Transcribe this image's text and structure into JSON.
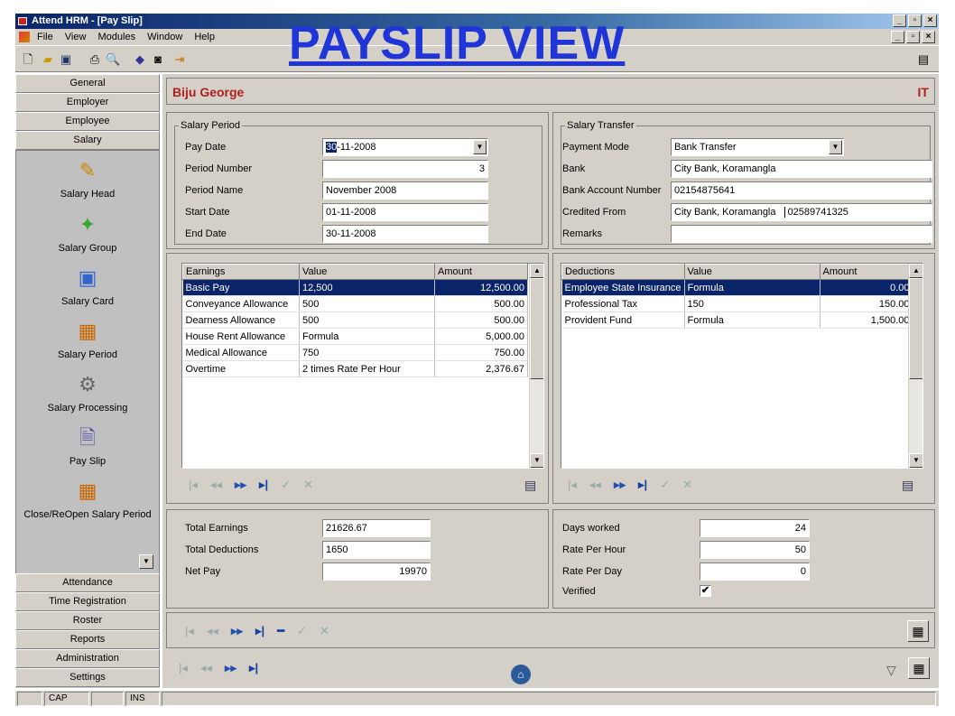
{
  "window": {
    "title": "Attend HRM - [Pay Slip]"
  },
  "menu": [
    "File",
    "View",
    "Modules",
    "Window",
    "Help"
  ],
  "overlay_title": "PAYSLIP VIEW",
  "sidebar": {
    "top_buttons": [
      "General",
      "Employer",
      "Employee",
      "Salary"
    ],
    "items": [
      {
        "label": "Salary Head",
        "icon": "salary-head-icon"
      },
      {
        "label": "Salary Group",
        "icon": "salary-group-icon"
      },
      {
        "label": "Salary Card",
        "icon": "salary-card-icon"
      },
      {
        "label": "Salary Period",
        "icon": "calendar-icon"
      },
      {
        "label": "Salary Processing",
        "icon": "gear-icon"
      },
      {
        "label": "Pay Slip",
        "icon": "document-icon"
      },
      {
        "label": "Close/ReOpen Salary Period",
        "icon": "calendar-icon"
      }
    ],
    "bottom_buttons": [
      "Attendance",
      "Time Registration",
      "Roster",
      "Reports",
      "Administration",
      "Settings"
    ]
  },
  "employee": {
    "name": "Biju George",
    "department": "IT"
  },
  "salary_period": {
    "legend": "Salary Period",
    "pay_date_label": "Pay Date",
    "pay_date_day": "30",
    "pay_date_rest": "-11-2008",
    "period_number_label": "Period Number",
    "period_number": "3",
    "period_name_label": "Period Name",
    "period_name": "November 2008",
    "start_date_label": "Start Date",
    "start_date": "01-11-2008",
    "end_date_label": "End Date",
    "end_date": "30-11-2008"
  },
  "salary_transfer": {
    "legend": "Salary Transfer",
    "payment_mode_label": "Payment Mode",
    "payment_mode": "Bank Transfer",
    "bank_label": "Bank",
    "bank": "City Bank, Koramangla",
    "account_label": "Bank Account Number",
    "account": "02154875641",
    "credited_from_label": "Credited From",
    "credited_from": "City Bank, Koramangla",
    "credited_from_account": "02589741325",
    "remarks_label": "Remarks",
    "remarks": ""
  },
  "earnings": {
    "headers": [
      "Earnings",
      "Value",
      "Amount"
    ],
    "rows": [
      [
        "Basic Pay",
        "12,500",
        "12,500.00"
      ],
      [
        "Conveyance Allowance",
        "500",
        "500.00"
      ],
      [
        "Dearness Allowance",
        "500",
        "500.00"
      ],
      [
        "House Rent Allowance",
        "Formula",
        "5,000.00"
      ],
      [
        "Medical Allowance",
        "750",
        "750.00"
      ],
      [
        "Overtime",
        "2 times Rate Per Hour",
        "2,376.67"
      ]
    ]
  },
  "deductions": {
    "headers": [
      "Deductions",
      "Value",
      "Amount"
    ],
    "rows": [
      [
        "Employee State Insurance",
        "Formula",
        "0.00"
      ],
      [
        "Professional Tax",
        "150",
        "150.00"
      ],
      [
        "Provident Fund",
        "Formula",
        "1,500.00"
      ]
    ]
  },
  "totals": {
    "total_earnings_label": "Total Earnings",
    "total_earnings": "21626.67",
    "total_deductions_label": "Total Deductions",
    "total_deductions": "1650",
    "net_pay_label": "Net Pay",
    "net_pay": "19970"
  },
  "work": {
    "days_worked_label": "Days worked",
    "days_worked": "24",
    "rate_per_hour_label": "Rate Per Hour",
    "rate_per_hour": "50",
    "rate_per_day_label": "Rate Per Day",
    "rate_per_day": "0",
    "verified_label": "Verified",
    "verified": "✔"
  },
  "status": {
    "cap": "CAP",
    "ins": "INS"
  },
  "colors": {
    "accent": "#0a246a",
    "title_blue": "#1f35d8",
    "name_red": "#b02020"
  }
}
